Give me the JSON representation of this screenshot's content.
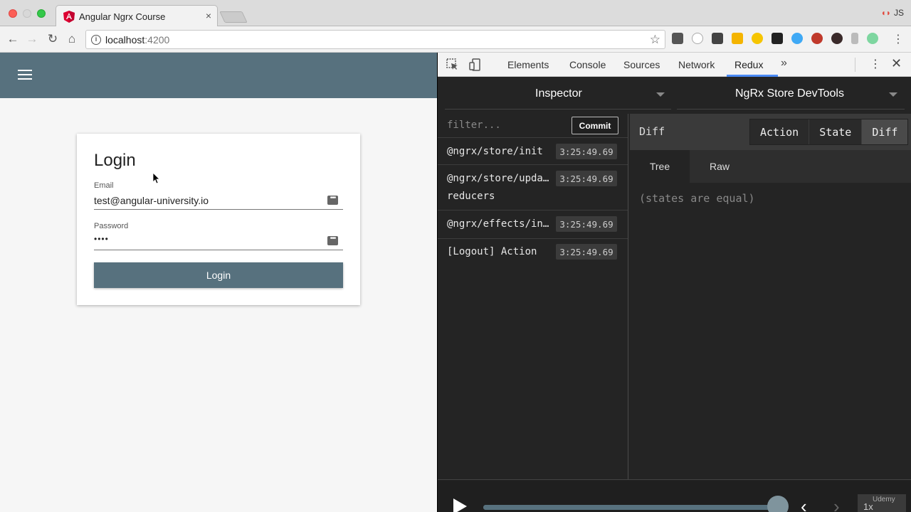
{
  "browser": {
    "tab_title": "Angular Ngrx Course",
    "tab_close": "×",
    "profile": "JS",
    "url_host": "localhost",
    "url_port": ":4200"
  },
  "login": {
    "title": "Login",
    "email_label": "Email",
    "email_value": "test@angular-university.io",
    "password_label": "Password",
    "password_value": "••••",
    "button": "Login"
  },
  "devtools": {
    "tabs": [
      "Elements",
      "Console",
      "Sources",
      "Network",
      "Redux"
    ],
    "active_tab": "Redux"
  },
  "redux": {
    "left_select": "Inspector",
    "right_select": "NgRx Store DevTools",
    "filter_placeholder": "filter...",
    "commit": "Commit",
    "actions": [
      {
        "name": "@ngrx/store/init",
        "time": "3:25:49.69"
      },
      {
        "name": "@ngrx/store/upda… reducers",
        "time": "3:25:49.69"
      },
      {
        "name": "@ngrx/effects/in…",
        "time": "3:25:49.69"
      },
      {
        "name": "[Logout] Action",
        "time": "3:25:49.69"
      }
    ],
    "diff_title": "Diff",
    "modes": [
      "Action",
      "State",
      "Diff"
    ],
    "active_mode": "Diff",
    "subtabs": [
      "Tree",
      "Raw"
    ],
    "active_subtab": "Tree",
    "diff_message": "(states are equal)",
    "speed": "1x",
    "slider_fraction": 1.0
  },
  "watermark": "Udemy",
  "colors": {
    "app_primary": "#57717e",
    "devtools_bg": "#242424",
    "active_tab_underline": "#4a8af4"
  }
}
